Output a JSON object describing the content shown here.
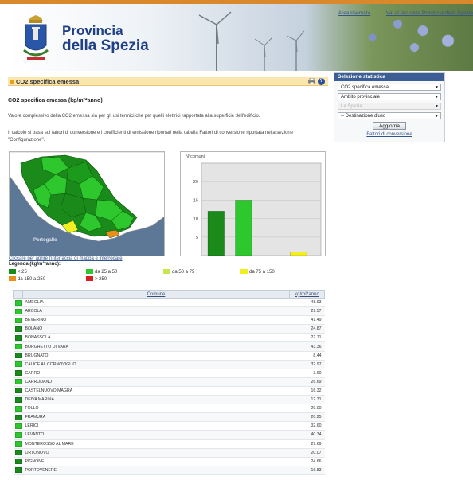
{
  "header": {
    "org_line1": "Provincia",
    "org_line2": "della Spezia",
    "links": [
      "Area riservata",
      "Vai al sito della Provincia della Spezia"
    ]
  },
  "section": {
    "title": "CO2 specifica emessa",
    "subtitle": "CO2 specifica emessa (kg/m²*anno)",
    "desc1": "Valore complessivo della CO2 emessa sia per gli usi termici che per quelli elettrici rapportata alla superficie dell'edificio.",
    "desc2": "Il calcolo si basa sui fattori di conversione e i coefficienti di emissione riportati nella tabella Fattori di conversione riportata nella sezione \"Configurazione\"."
  },
  "panel": {
    "title": "Selezione statistica",
    "selects": [
      {
        "value": "CO2 specifica emessa",
        "disabled": false
      },
      {
        "value": "Ambito provinciale",
        "disabled": false
      },
      {
        "value": "La Spezia",
        "disabled": true
      },
      {
        "value": "-- Destinazione d'uso",
        "disabled": false
      }
    ],
    "button": "Aggiorna",
    "link": "Fattori di conversione"
  },
  "map": {
    "link": "Cliccare per aprire l'interfaccia di mappa e interrogare",
    "label": "Portogallo"
  },
  "chart_data": {
    "type": "bar",
    "title": "",
    "xlabel": "",
    "ylabel": "N°comuni",
    "categories": [
      "< 25",
      "da 25 a 50",
      "da 50 a 75",
      "da 75 a 150"
    ],
    "values": [
      12,
      15,
      0,
      1
    ],
    "colors": [
      "#1a8a1a",
      "#2ec82e",
      "#c7e84a",
      "#f2ee22"
    ],
    "yticks": [
      5,
      10,
      15,
      20
    ],
    "ylim": [
      0,
      25
    ],
    "grid": true
  },
  "legend": {
    "title": "Legenda (kg/m²*anno):",
    "items": [
      {
        "label": "< 25",
        "color": "#1a8a1a"
      },
      {
        "label": "da 25 a 50",
        "color": "#2ec82e"
      },
      {
        "label": "da 50 a 75",
        "color": "#c7e84a"
      },
      {
        "label": "da 75 a 150",
        "color": "#f2ee22"
      },
      {
        "label": "da 150 a 250",
        "color": "#e8901c"
      },
      {
        "label": "> 250",
        "color": "#d81e1e"
      }
    ]
  },
  "table": {
    "headers": [
      "Comune",
      "kg/m²*anno"
    ],
    "rows": [
      {
        "name": "AMEGLIA",
        "value": "48.93",
        "color": "#2ec82e"
      },
      {
        "name": "ARCOLA",
        "value": "29.57",
        "color": "#2ec82e"
      },
      {
        "name": "BEVERINO",
        "value": "41.49",
        "color": "#2ec82e"
      },
      {
        "name": "BOLANO",
        "value": "24.87",
        "color": "#1a8a1a"
      },
      {
        "name": "BONASSOLA",
        "value": "22.71",
        "color": "#1a8a1a"
      },
      {
        "name": "BORGHETTO DI VARA",
        "value": "43.36",
        "color": "#2ec82e"
      },
      {
        "name": "BRUGNATO",
        "value": "8.44",
        "color": "#1a8a1a"
      },
      {
        "name": "CALICE AL CORNOVIGLIO",
        "value": "32.97",
        "color": "#2ec82e"
      },
      {
        "name": "CARRO",
        "value": "3.60",
        "color": "#1a8a1a"
      },
      {
        "name": "CARRODANO",
        "value": "26.69",
        "color": "#2ec82e"
      },
      {
        "name": "CASTELNUOVO MAGRA",
        "value": "16.32",
        "color": "#1a8a1a"
      },
      {
        "name": "DEIVA MARINA",
        "value": "12.31",
        "color": "#1a8a1a"
      },
      {
        "name": "FOLLO",
        "value": "29.00",
        "color": "#2ec82e"
      },
      {
        "name": "FRAMURA",
        "value": "20.25",
        "color": "#1a8a1a"
      },
      {
        "name": "LERICI",
        "value": "32.60",
        "color": "#2ec82e"
      },
      {
        "name": "LEVANTO",
        "value": "40.34",
        "color": "#2ec82e"
      },
      {
        "name": "MONTEROSSO AL MARE",
        "value": "29.69",
        "color": "#2ec82e"
      },
      {
        "name": "ORTONOVO",
        "value": "20.07",
        "color": "#1a8a1a"
      },
      {
        "name": "PIGNONE",
        "value": "24.66",
        "color": "#1a8a1a"
      },
      {
        "name": "PORTOVENERE",
        "value": "16.83",
        "color": "#1a8a1a"
      }
    ]
  }
}
